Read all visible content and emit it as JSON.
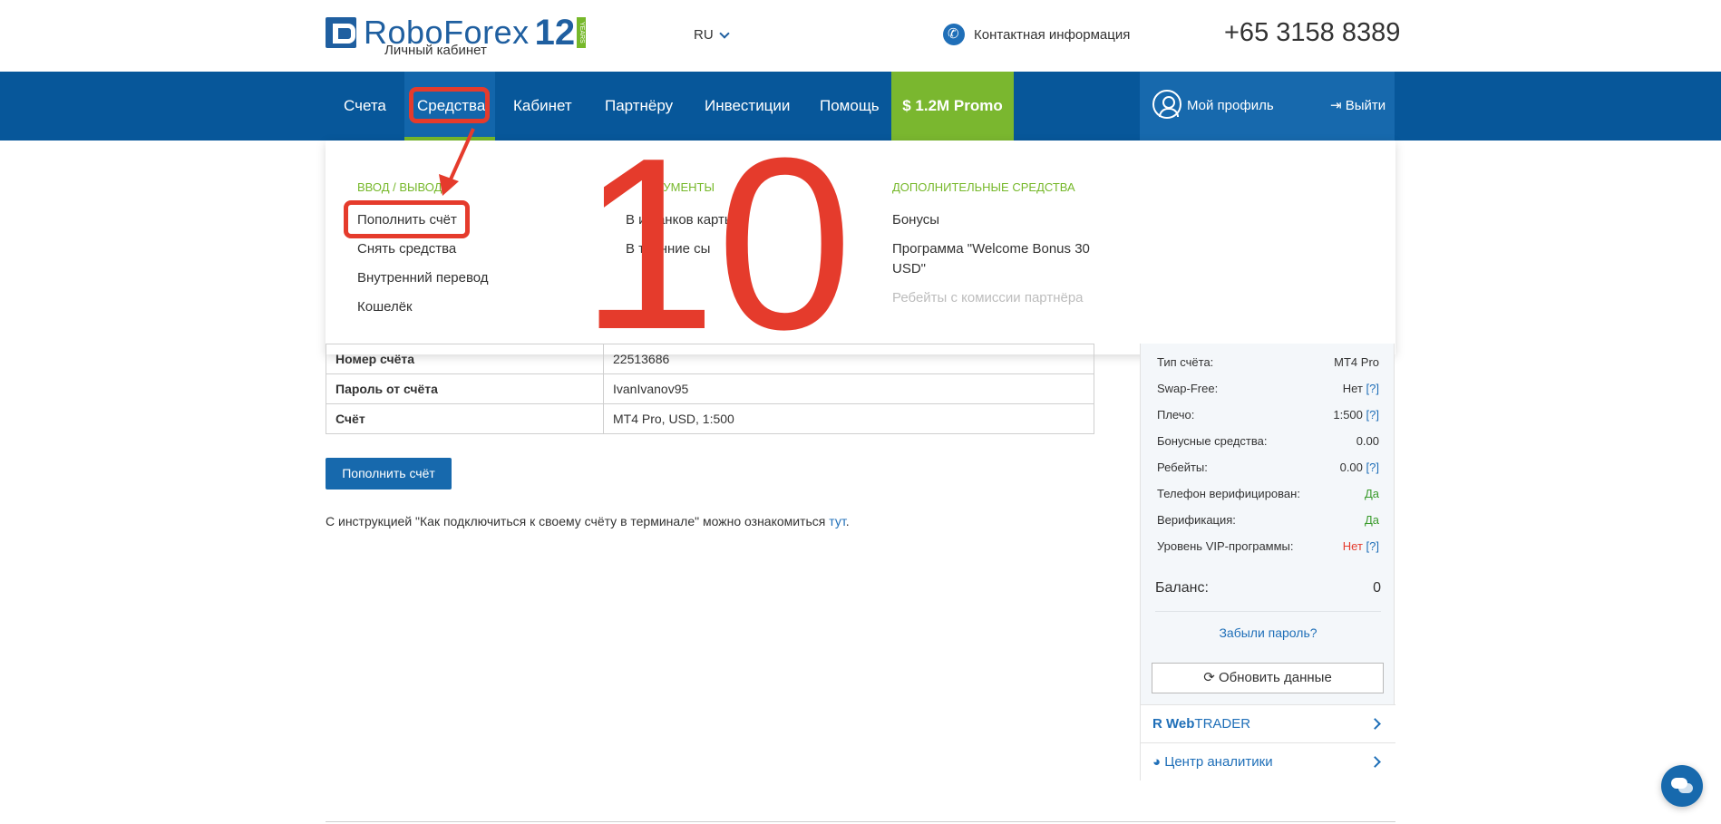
{
  "header": {
    "logo_text": "RoboForex",
    "logo_years": "12",
    "logo_badge": "YEARS",
    "logo_subtitle": "Личный кабинет",
    "language": "RU",
    "contact_label": "Контактная информация",
    "phone": "+65 3158 8389"
  },
  "nav": {
    "items": [
      "Счета",
      "Средства",
      "Кабинет",
      "Партнёру",
      "Инвестиции",
      "Помощь",
      "$ 1.2M Promo"
    ],
    "profile_label": "Мой профиль",
    "logout_label": "Выйти"
  },
  "dropdown": {
    "col1": {
      "heading": "ВВОД / ВЫВОД",
      "links": [
        "Пополнить счёт",
        "Снять средства",
        "Внутренний перевод",
        "Кошелёк"
      ]
    },
    "col2": {
      "heading": "РУМЕНТЫ",
      "links": [
        "В   и банков    карты",
        "В   тренние     сы"
      ]
    },
    "col3": {
      "heading": "ДОПОЛНИТЕЛЬНЫЕ СРЕДСТВА",
      "links": [
        "Бонусы",
        "Программа \"Welcome Bonus 30",
        "USD\""
      ],
      "disabled_link": "Ребейты с комиссии партнёра"
    }
  },
  "account_table": {
    "rows": [
      {
        "key": "Номер счёта",
        "value": "22513686"
      },
      {
        "key": "Пароль от счёта",
        "value": "IvanIvanov95"
      },
      {
        "key": "Счёт",
        "value": "MT4 Pro, USD, 1:500"
      }
    ]
  },
  "topup_button": "Пополнить счёт",
  "instruction": {
    "text": "С инструкцией \"Как подключиться к своему счёту в терминале\" можно ознакомиться",
    "link": "тут",
    "suffix": "."
  },
  "sidebar": {
    "rows": [
      {
        "key": "Тип счёта:",
        "value": "MT4 Pro",
        "help": ""
      },
      {
        "key": "Swap-Free:",
        "value": "Нет",
        "help": "[?]"
      },
      {
        "key": "Плечо:",
        "value": "1:500",
        "help": "[?]"
      },
      {
        "key": "Бонусные средства:",
        "value": "0.00",
        "help": ""
      },
      {
        "key": "Ребейты:",
        "value": "0.00",
        "help": "[?]"
      },
      {
        "key": "Телефон верифицирован:",
        "value": "Да",
        "help": ""
      },
      {
        "key": "Верификация:",
        "value": "Да",
        "help": ""
      },
      {
        "key": "Уровень VIP-программы:",
        "value": "Нет",
        "help": "[?]"
      }
    ],
    "balance_label": "Баланс:",
    "balance_value": "0",
    "forgot_password": "Забыли пароль?",
    "refresh_button": "Обновить данные",
    "webtrader_bold": "Web",
    "webtrader_rest": "TRADER",
    "analytics_label": "Центр аналитики"
  },
  "annotation": {
    "step_number": "10",
    "color": "#e53b2c"
  },
  "colors": {
    "nav_bg": "#07579a",
    "accent_green": "#76b82a",
    "brand_blue": "#1f5fa0",
    "link_blue": "#1f6fb8"
  }
}
